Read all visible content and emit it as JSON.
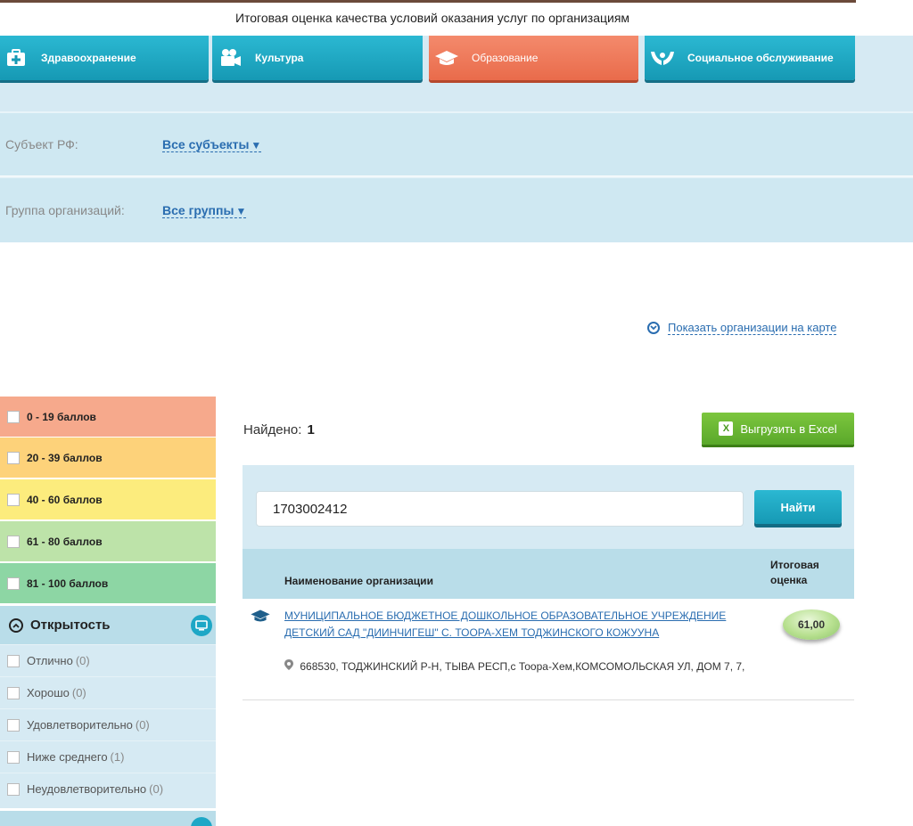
{
  "header": {
    "title": "Итоговая оценка качества условий оказания услуг по организациям"
  },
  "sectors": [
    {
      "label": "Здравоохранение",
      "icon": "medkit-icon"
    },
    {
      "label": "Культура",
      "icon": "film-camera-icon"
    },
    {
      "label": "Образование",
      "icon": "graduation-cap-icon",
      "active": true
    },
    {
      "label": "Социальное обслуживание",
      "icon": "caring-hands-icon"
    }
  ],
  "filters": {
    "subject_label": "Субъект РФ:",
    "subject_value": "Все субъекты",
    "group_label": "Группа организаций:",
    "group_value": "Все группы"
  },
  "map_link": "Показать организации на карте",
  "score_ranges": [
    {
      "label": "0 - 19 баллов",
      "color": "#f6a98c"
    },
    {
      "label": "20 - 39 баллов",
      "color": "#fdd27a"
    },
    {
      "label": "40 - 60 баллов",
      "color": "#fcec7d"
    },
    {
      "label": "61 - 80 баллов",
      "color": "#bde3a9"
    },
    {
      "label": "81 - 100 баллов",
      "color": "#8dd6a4"
    }
  ],
  "openness": {
    "title": "Открытость",
    "options": [
      {
        "label": "Отлично",
        "count": "(0)"
      },
      {
        "label": "Хорошо",
        "count": "(0)"
      },
      {
        "label": "Удовлетворительно",
        "count": "(0)"
      },
      {
        "label": "Ниже среднего",
        "count": "(1)"
      },
      {
        "label": "Неудовлетворительно",
        "count": "(0)"
      }
    ]
  },
  "results": {
    "found_label": "Найдено:",
    "found_count": "1",
    "excel_label": "Выгрузить в Excel"
  },
  "search": {
    "value": "1703002412",
    "button_label": "Найти"
  },
  "table": {
    "col_name": "Наименование организации",
    "col_score": "Итоговая оценка",
    "rows": [
      {
        "name": "МУНИЦИПАЛЬНОЕ БЮДЖЕТНОЕ ДОШКОЛЬНОЕ ОБРАЗОВАТЕЛЬНОЕ УЧРЕЖДЕНИЕ ДЕТСКИЙ САД \"ДИИНЧИГЕШ\" С. ТООРА-ХЕМ ТОДЖИНСКОГО КОЖУУНА",
        "address": "668530, ТОДЖИНСКИЙ Р-Н, ТЫВА РЕСП,с Тоора-Хем,КОМСОМОЛЬСКАЯ УЛ, ДОМ 7, 7,",
        "score": "61,00"
      }
    ]
  },
  "colors": {
    "accent": "#1ea7c6",
    "active_tab": "#ee7656",
    "excel_green": "#6bb734",
    "panel": "#d6eaf3"
  }
}
